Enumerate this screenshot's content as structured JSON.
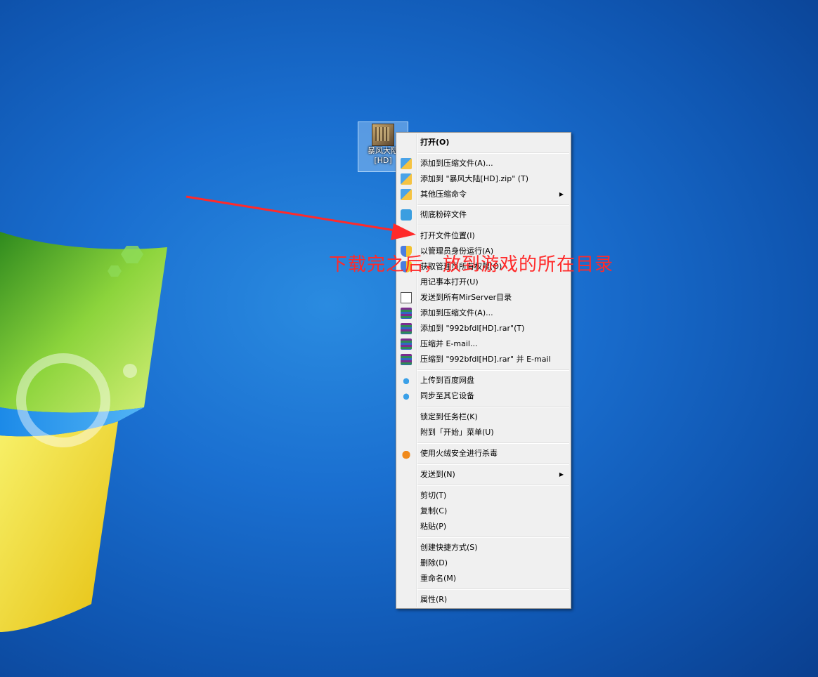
{
  "desktop_icon": {
    "label": "暴风大陆\n[HD]",
    "icon": "game-file-icon"
  },
  "annotation": "下载完之后，放到游戏的所在目录",
  "menu": {
    "open": "打开(O)",
    "add_archive_zip": "添加到压缩文件(A)...",
    "add_to_zip": "添加到 \"暴风大陆[HD].zip\" (T)",
    "other_compress": "其他压缩命令",
    "shred": "彻底粉碎文件",
    "open_location": "打开文件位置(I)",
    "run_as_admin": "以管理员身份运行(A)",
    "take_ownership": "获取管理员所有权限(O)",
    "open_notepad": "用记事本打开(U)",
    "send_mirserver": "发送到所有MirServer目录",
    "add_archive_rar": "添加到压缩文件(A)...",
    "add_to_rar": "添加到 \"992bfdl[HD].rar\"(T)",
    "compress_email": "压缩并 E-mail...",
    "compress_rar_email": "压缩到 \"992bfdl[HD].rar\" 并 E-mail",
    "upload_baidu": "上传到百度网盘",
    "sync_devices": "同步至其它设备",
    "pin_taskbar": "锁定到任务栏(K)",
    "pin_start": "附到「开始」菜单(U)",
    "scan_huorong": "使用火绒安全进行杀毒",
    "send_to": "发送到(N)",
    "cut": "剪切(T)",
    "copy": "复制(C)",
    "paste": "粘贴(P)",
    "create_shortcut": "创建快捷方式(S)",
    "delete": "删除(D)",
    "rename": "重命名(M)",
    "properties": "属性(R)"
  },
  "colors": {
    "annotation": "#ff2a2a",
    "desktop": "#1a6fd0",
    "menu_bg": "#f0f0f0"
  }
}
